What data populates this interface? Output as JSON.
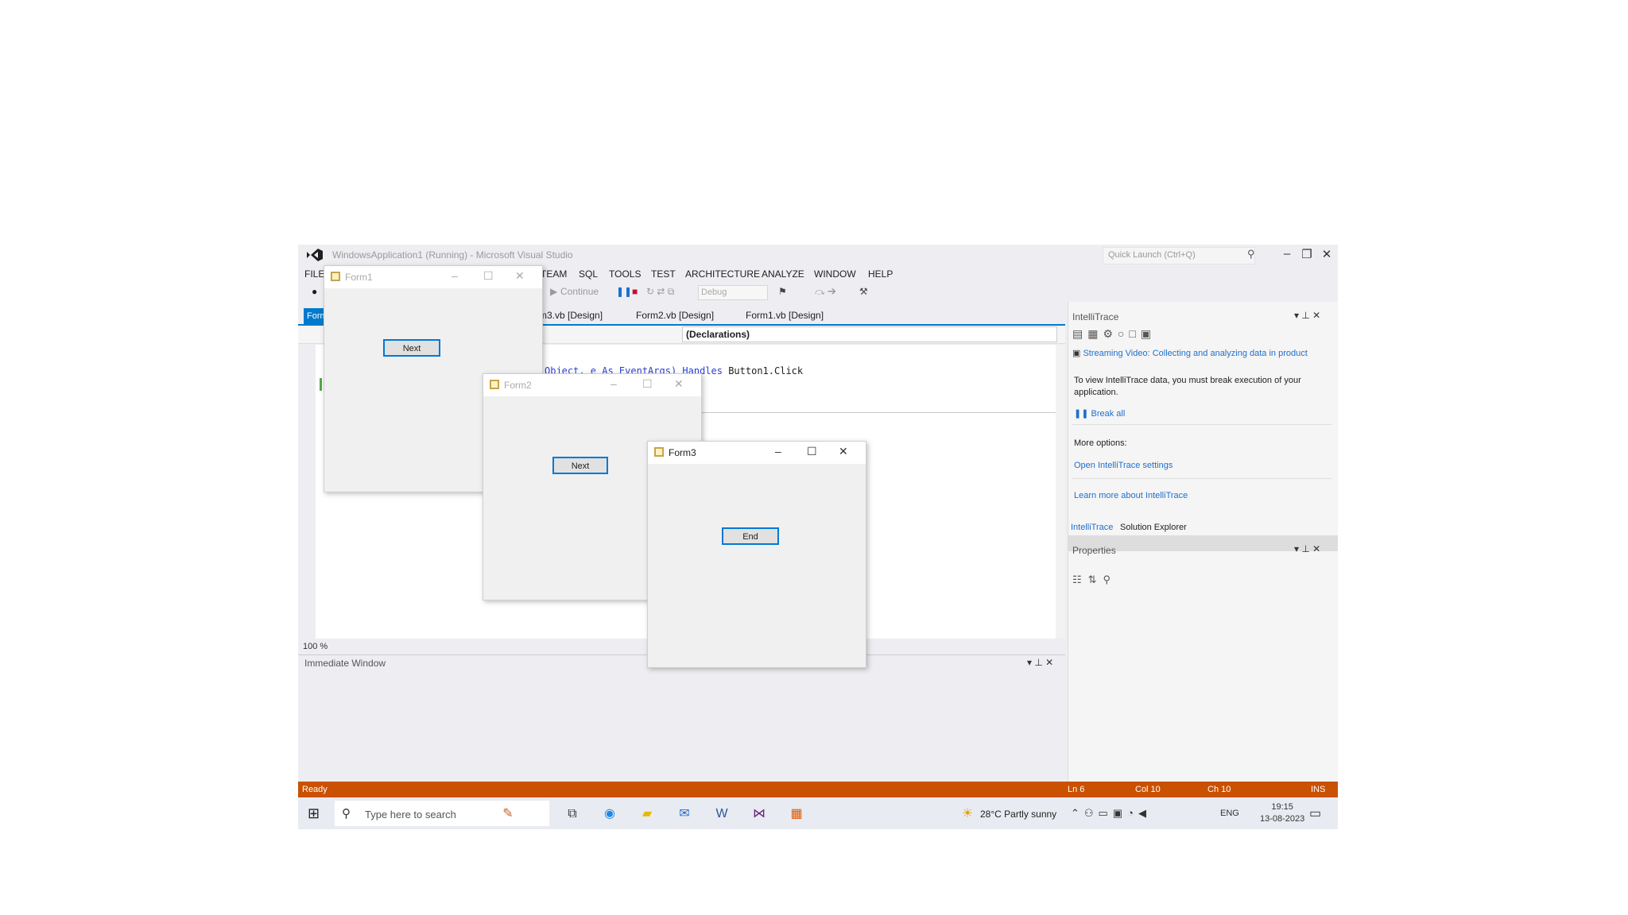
{
  "window": {
    "title": "WindowsApplication1 (Running) - Microsoft Visual Studio",
    "quick_launch_placeholder": "Quick Launch (Ctrl+Q)"
  },
  "menu": [
    "FILE",
    "TEAM",
    "SQL",
    "TOOLS",
    "TEST",
    "ARCHITECTURE",
    "ANALYZE",
    "WINDOW",
    "HELP"
  ],
  "toolbar": {
    "continue_label": "Continue",
    "config_value": "Debug"
  },
  "doc_tabs": {
    "active_label": "Form",
    "tabs": [
      "m3.vb [Design]",
      "Form2.vb [Design]",
      "Form1.vb [Design]"
    ]
  },
  "nav": {
    "right": "(Declarations)"
  },
  "code": {
    "line_kw": "Object, e As EventArgs) Handles",
    "line_tail": " Button1.Click"
  },
  "zoom": "100 %",
  "immediate": {
    "title": "Immediate Window"
  },
  "intellitrace": {
    "title": "IntelliTrace",
    "streaming": "Streaming Video: Collecting and analyzing data in product",
    "message": "To view IntelliTrace data, you must break execution of your application.",
    "break_all": "Break all",
    "more_options": "More options:",
    "open_settings": "Open IntelliTrace settings",
    "learn_more": "Learn more about IntelliTrace"
  },
  "panel_tabs": [
    "IntelliTrace",
    "Solution Explorer"
  ],
  "properties": {
    "title": "Properties"
  },
  "status": {
    "ready": "Ready",
    "ln": "Ln 6",
    "col": "Col 10",
    "ch": "Ch 10",
    "ins": "INS",
    "color": "#ca5100"
  },
  "taskbar": {
    "search_placeholder": "Type here to search",
    "weather": "28°C  Partly sunny",
    "lang": "ENG",
    "time": "19:15",
    "date": "13-08-2023"
  },
  "forms": {
    "form1": {
      "title": "Form1",
      "button": "Next"
    },
    "form2": {
      "title": "Form2",
      "button": "Next"
    },
    "form3": {
      "title": "Form3",
      "button": "End"
    }
  }
}
